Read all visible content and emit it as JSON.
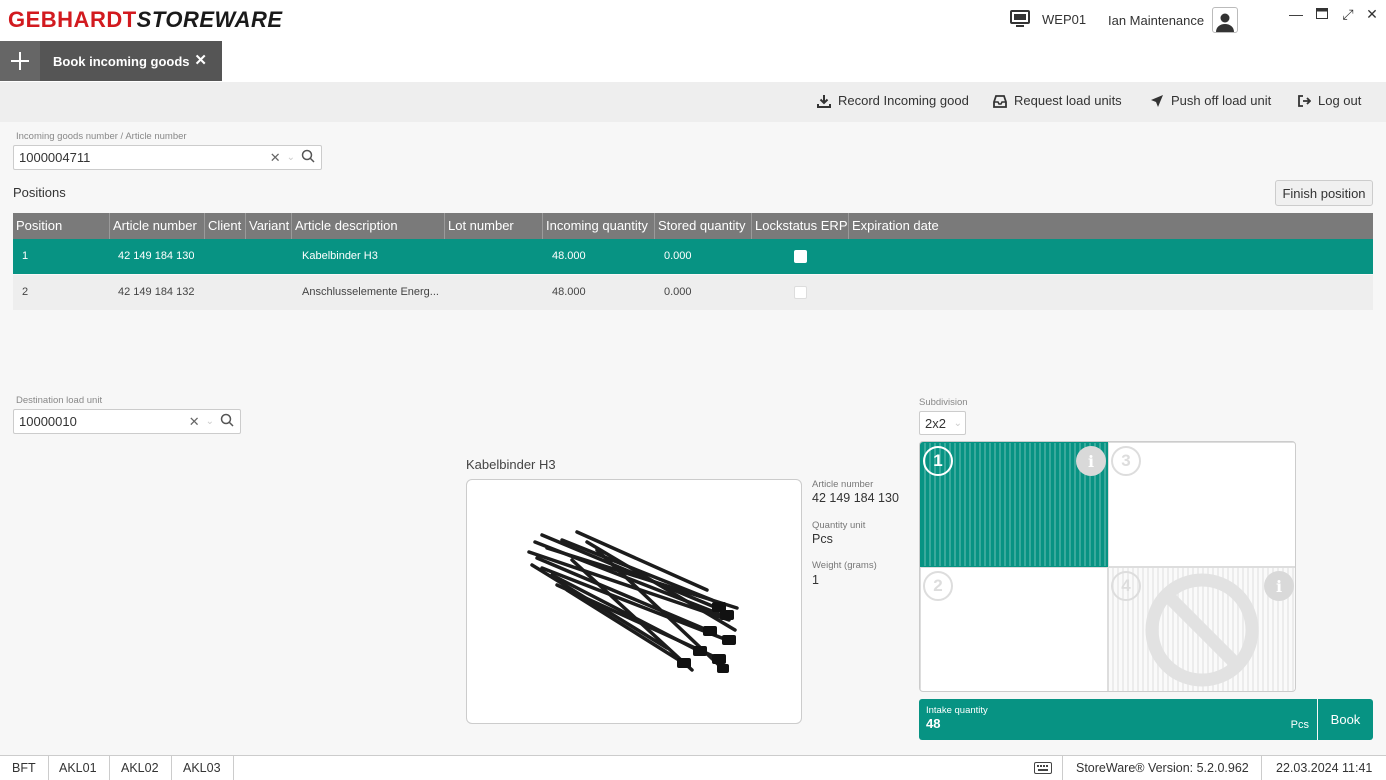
{
  "app": {
    "brand_part1": "GEBHARDT",
    "brand_part2": "STOREWARE",
    "brand_color": "#d21a1f",
    "accent_color": "#079383",
    "station": "WEP01",
    "user": "Ian Maintenance"
  },
  "tabs": [
    {
      "label": "Book incoming goods",
      "active": true
    }
  ],
  "toolbar": {
    "record_label": "Record Incoming good",
    "request_label": "Request load units",
    "push_label": "Push off load unit",
    "logout_label": "Log out"
  },
  "search": {
    "label": "Incoming goods number / Article number",
    "value": "1000004711"
  },
  "positions": {
    "title": "Positions",
    "finish_label": "Finish position",
    "columns": [
      "Position",
      "Article number",
      "Client",
      "Variant",
      "Article description",
      "Lot number",
      "Incoming quantity",
      "Stored quantity",
      "Lockstatus ERP",
      "Expiration date"
    ],
    "rows": [
      {
        "position": "1",
        "article_number": "42 149 184 130",
        "client": "",
        "variant": "",
        "description": "Kabelbinder H3",
        "lot": "",
        "incoming_qty": "48.000",
        "stored_qty": "0.000",
        "lock": false,
        "expiration": "",
        "selected": true
      },
      {
        "position": "2",
        "article_number": "42 149 184 132",
        "client": "",
        "variant": "",
        "description": "Anschlusselemente Energ...",
        "lot": "",
        "incoming_qty": "48.000",
        "stored_qty": "0.000",
        "lock": false,
        "expiration": "",
        "selected": false
      }
    ]
  },
  "destination": {
    "label": "Destination load unit",
    "value": "10000010"
  },
  "article": {
    "name": "Kabelbinder H3",
    "article_number_label": "Article number",
    "article_number": "42 149 184 130",
    "quantity_unit_label": "Quantity unit",
    "quantity_unit": "Pcs",
    "weight_label": "Weight (grams)",
    "weight": "1"
  },
  "subdivision": {
    "label": "Subdivision",
    "value": "2x2",
    "cells": [
      {
        "number": "1",
        "state": "active",
        "info": true
      },
      {
        "number": "3",
        "state": "empty",
        "info": false
      },
      {
        "number": "2",
        "state": "empty",
        "info": false
      },
      {
        "number": "4",
        "state": "blocked",
        "info": true
      }
    ]
  },
  "intake": {
    "label": "Intake quantity",
    "value": "48",
    "unit": "Pcs",
    "book_label": "Book"
  },
  "statusbar": {
    "items": [
      "BFT",
      "AKL01",
      "AKL02",
      "AKL03"
    ],
    "version": "StoreWare® Version: 5.2.0.962",
    "datetime": "22.03.2024 11:41"
  }
}
